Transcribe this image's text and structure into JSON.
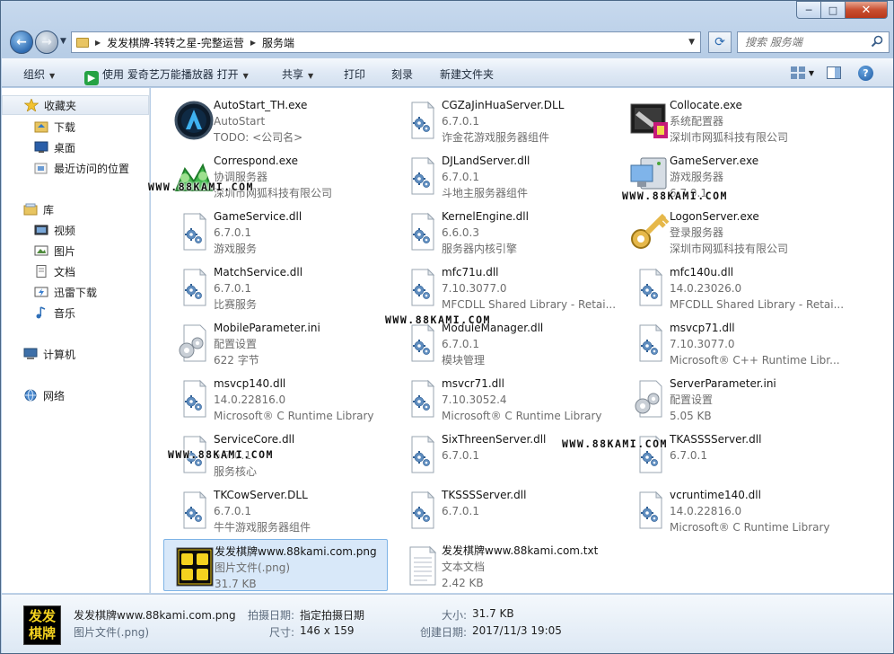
{
  "window": {
    "controls": {
      "minimize": "─",
      "maximize": "□",
      "close": "✕"
    }
  },
  "address_bar": {
    "breadcrumbs": [
      "发发棋牌-转转之星-完整运营",
      "服务端"
    ],
    "search_placeholder": "搜索 服务端"
  },
  "toolbar": {
    "organize": "组织",
    "open_with": "使用 爱奇艺万能播放器 打开",
    "share": "共享",
    "print": "打印",
    "burn": "刻录",
    "new_folder": "新建文件夹",
    "help": "?"
  },
  "nav_pane": {
    "favorites": {
      "label": "收藏夹",
      "items": [
        "下载",
        "桌面",
        "最近访问的位置"
      ]
    },
    "libraries": {
      "label": "库",
      "items": [
        "视频",
        "图片",
        "文档",
        "迅雷下载",
        "音乐"
      ]
    },
    "computer": "计算机",
    "network": "网络"
  },
  "files": [
    {
      "name": "AutoStart_TH.exe",
      "line2": "AutoStart",
      "line3": "TODO: <公司名>",
      "icon": "autostart-app-icon"
    },
    {
      "name": "CGZaJinHuaServer.DLL",
      "line2": "6.7.0.1",
      "line3": "诈金花游戏服务器组件",
      "icon": "dll-gear-icon"
    },
    {
      "name": "Collocate.exe",
      "line2": "系统配置器",
      "line3": "深圳市网狐科技有限公司",
      "icon": "collocate-app-icon"
    },
    {
      "name": "Correspond.exe",
      "line2": "协调服务器",
      "line3": "深圳市网狐科技有限公司",
      "icon": "correspond-app-icon"
    },
    {
      "name": "DJLandServer.dll",
      "line2": "6.7.0.1",
      "line3": "斗地主服务器组件",
      "icon": "dll-gear-icon"
    },
    {
      "name": "GameServer.exe",
      "line2": "游戏服务器",
      "line3": "6.7.0.1",
      "icon": "gameserver-app-icon"
    },
    {
      "name": "GameService.dll",
      "line2": "6.7.0.1",
      "line3": "游戏服务",
      "icon": "dll-gear-icon"
    },
    {
      "name": "KernelEngine.dll",
      "line2": "6.6.0.3",
      "line3": "服务器内核引擎",
      "icon": "dll-gear-icon"
    },
    {
      "name": "LogonServer.exe",
      "line2": "登录服务器",
      "line3": "深圳市网狐科技有限公司",
      "icon": "key-app-icon"
    },
    {
      "name": "MatchService.dll",
      "line2": "6.7.0.1",
      "line3": "比赛服务",
      "icon": "dll-gear-icon"
    },
    {
      "name": "mfc71u.dll",
      "line2": "7.10.3077.0",
      "line3": "MFCDLL Shared Library - Retai...",
      "icon": "dll-gear-icon"
    },
    {
      "name": "mfc140u.dll",
      "line2": "14.0.23026.0",
      "line3": "MFCDLL Shared Library - Retai...",
      "icon": "dll-gear-icon"
    },
    {
      "name": "MobileParameter.ini",
      "line2": "配置设置",
      "line3": "622 字节",
      "icon": "ini-settings-icon"
    },
    {
      "name": "ModuleManager.dll",
      "line2": "6.7.0.1",
      "line3": "模块管理",
      "icon": "dll-gear-icon"
    },
    {
      "name": "msvcp71.dll",
      "line2": "7.10.3077.0",
      "line3": "Microsoft® C++ Runtime Libr...",
      "icon": "dll-gear-icon"
    },
    {
      "name": "msvcp140.dll",
      "line2": "14.0.22816.0",
      "line3": "Microsoft® C Runtime Library",
      "icon": "dll-gear-icon"
    },
    {
      "name": "msvcr71.dll",
      "line2": "7.10.3052.4",
      "line3": "Microsoft® C Runtime Library",
      "icon": "dll-gear-icon"
    },
    {
      "name": "ServerParameter.ini",
      "line2": "配置设置",
      "line3": "5.05 KB",
      "icon": "ini-settings-icon"
    },
    {
      "name": "ServiceCore.dll",
      "line2": "6.7.0.1",
      "line3": "服务核心",
      "icon": "dll-gear-icon"
    },
    {
      "name": "SixThreenServer.dll",
      "line2": "6.7.0.1",
      "line3": "",
      "icon": "dll-gear-icon"
    },
    {
      "name": "TKASSSServer.dll",
      "line2": "6.7.0.1",
      "line3": "",
      "icon": "dll-gear-icon"
    },
    {
      "name": "TKCowServer.DLL",
      "line2": "6.7.0.1",
      "line3": "牛牛游戏服务器组件",
      "icon": "dll-gear-icon"
    },
    {
      "name": "TKSSSServer.dll",
      "line2": "6.7.0.1",
      "line3": "",
      "icon": "dll-gear-icon"
    },
    {
      "name": "vcruntime140.dll",
      "line2": "14.0.22816.0",
      "line3": "Microsoft® C Runtime Library",
      "icon": "dll-gear-icon"
    },
    {
      "name": "发发棋牌www.88kami.com.png",
      "line2": "图片文件(.png)",
      "line3": "31.7 KB",
      "icon": "png-thumbnail-icon",
      "selected": true
    },
    {
      "name": "发发棋牌www.88kami.com.txt",
      "line2": "文本文档",
      "line3": "2.42 KB",
      "icon": "txt-document-icon"
    }
  ],
  "watermark": "WWW.88KAMI.COM",
  "thumb_text": "发发棋牌",
  "details": {
    "filename": "发发棋牌www.88kami.com.png",
    "filetype": "图片文件(.png)",
    "date_taken_label": "拍摄日期:",
    "date_taken_value": "指定拍摄日期",
    "dimensions_label": "尺寸:",
    "dimensions_value": "146 x 159",
    "size_label": "大小:",
    "size_value": "31.7 KB",
    "created_label": "创建日期:",
    "created_value": "2017/11/3 19:05"
  },
  "colors": {
    "selection": "#d8e8f9",
    "selection_border": "#7db3e6",
    "close_button": "#c94f31"
  }
}
